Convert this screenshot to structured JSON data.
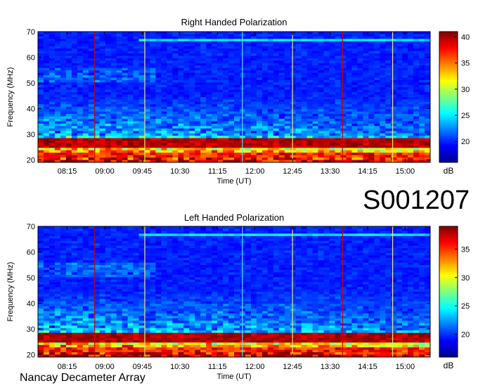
{
  "observation_id": "S001207",
  "footer_label": "Nancay Decameter Array",
  "colorbar_unit": "dB",
  "chart_data": [
    {
      "type": "heatmap",
      "title": "Right Handed Polarization",
      "xlabel": "Time (UT)",
      "ylabel": "Frequency (MHz)",
      "x_ticks": [
        "08:15",
        "09:00",
        "09:45",
        "10:30",
        "11:15",
        "12:00",
        "12:45",
        "13:30",
        "14:15",
        "15:00"
      ],
      "x_range": [
        "07:40",
        "15:30"
      ],
      "y_ticks": [
        20,
        30,
        40,
        50,
        60,
        70
      ],
      "ylim": [
        19,
        70
      ],
      "colorbar": {
        "ticks": [
          20,
          25,
          30,
          35,
          40
        ],
        "range": [
          16,
          41
        ],
        "label": "dB"
      },
      "markers": [
        {
          "time": "08:48",
          "color": "#cc0000"
        },
        {
          "time": "09:48",
          "color": "#e8e870"
        },
        {
          "time": "11:45",
          "color": "#5fe0f0"
        },
        {
          "time": "12:45",
          "color": "#e8e870"
        },
        {
          "time": "13:45",
          "color": "#cc0000"
        },
        {
          "time": "14:45",
          "color": "#e8e870"
        }
      ]
    },
    {
      "type": "heatmap",
      "title": "Left Handed Polarization",
      "xlabel": "Time (UT)",
      "ylabel": "Frequency (MHz)",
      "x_ticks": [
        "08:15",
        "09:00",
        "09:45",
        "10:30",
        "11:15",
        "12:00",
        "12:45",
        "13:30",
        "14:15",
        "15:00"
      ],
      "x_range": [
        "07:40",
        "15:30"
      ],
      "y_ticks": [
        20,
        30,
        40,
        50,
        60,
        70
      ],
      "ylim": [
        19,
        70
      ],
      "colorbar": {
        "ticks": [
          20,
          25,
          30,
          35
        ],
        "range": [
          16,
          39
        ],
        "label": "dB"
      },
      "markers": [
        {
          "time": "08:48",
          "color": "#cc0000"
        },
        {
          "time": "09:48",
          "color": "#e8e870"
        },
        {
          "time": "11:45",
          "color": "#5fe0f0"
        },
        {
          "time": "12:45",
          "color": "#e8e870"
        },
        {
          "time": "13:45",
          "color": "#cc0000"
        },
        {
          "time": "14:45",
          "color": "#e8e870"
        }
      ]
    }
  ]
}
